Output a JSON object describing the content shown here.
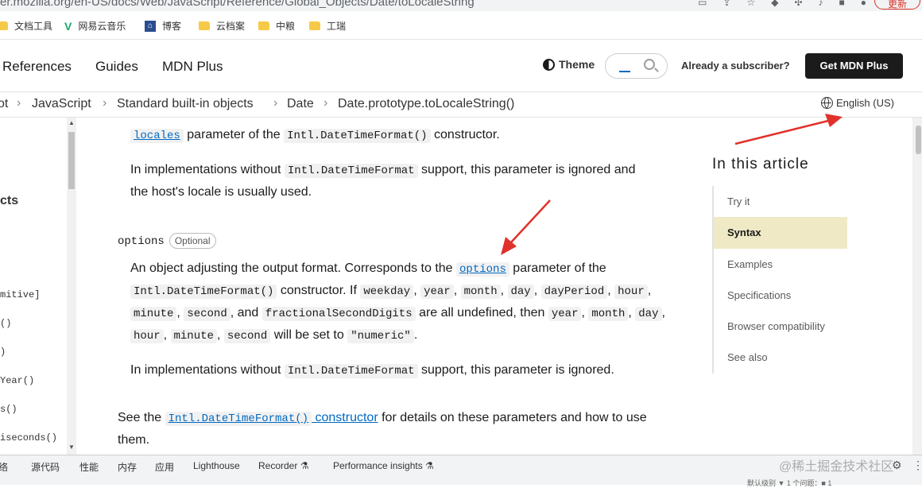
{
  "browser": {
    "url": "er.mozilla.org/en-US/docs/Web/JavaScript/Reference/Global_Objects/Date/toLocaleString",
    "update_label": "更新",
    "bookmarks": [
      "文档工具",
      "网易云音乐",
      "博客",
      "云档案",
      "中粮",
      "工瑞"
    ]
  },
  "header": {
    "nav": [
      "References",
      "Guides",
      "MDN Plus"
    ],
    "theme_label": "Theme",
    "subscriber_label": "Already a subscriber?",
    "cta_label": "Get MDN Plus"
  },
  "breadcrumb": {
    "items": [
      "ot",
      "JavaScript",
      "Standard built-in objects",
      "Date",
      "Date.prototype.toLocaleString()"
    ],
    "language": "English (US)"
  },
  "sidebar": {
    "heading": "cts",
    "items": [
      "mitive]",
      "()",
      ")",
      "Year()",
      "s()",
      "iseconds()"
    ]
  },
  "content": {
    "p1": {
      "link": "locales",
      "text1": "parameter of the",
      "code": "Intl.DateTimeFormat()",
      "text2": "constructor."
    },
    "p2": {
      "text1": "In implementations without",
      "code": "Intl.DateTimeFormat",
      "text2": "support, this parameter is ignored and",
      "line2": "the host's locale is usually used."
    },
    "options_term": "options",
    "optional_badge": "Optional",
    "p3": {
      "text1": "An object adjusting the output format. Corresponds to the",
      "link": "options",
      "text2": "parameter of the",
      "code_ctor": "Intl.DateTimeFormat()",
      "text3": "constructor. If",
      "codes": [
        "weekday",
        "year",
        "month",
        "day",
        "dayPeriod",
        "hour",
        "minute",
        "second",
        "fractionalSecondDigits",
        "year",
        "month",
        "day",
        "hour",
        "minute",
        "second",
        "\"numeric\""
      ],
      "and": "and",
      "undefined_then": "are all undefined, then",
      "will_be": "will be set to"
    },
    "p4": {
      "text1": "In implementations without",
      "code": "Intl.DateTimeFormat",
      "text2": "support, this parameter is ignored."
    },
    "p5": {
      "text1": "See the",
      "link_code": "Intl.DateTimeFormat()",
      "link_text": "constructor",
      "text2": "for details on these parameters and how to use",
      "line2": "them."
    }
  },
  "toc": {
    "title": "In this article",
    "items": [
      "Try it",
      "Syntax",
      "Examples",
      "Specifications",
      "Browser compatibility",
      "See also"
    ],
    "active": "Syntax"
  },
  "devtools": {
    "tabs": [
      "络",
      "源代码",
      "性能",
      "内存",
      "应用",
      "Lighthouse",
      "Recorder ⚗",
      "Performance insights ⚗"
    ],
    "watermark": "@稀土掘金技术社区",
    "bottom": "默认级别 ▼   1 个问题：■ 1"
  },
  "colors": {
    "link": "#0069c2",
    "active_toc": "#efe9c6",
    "cta_bg": "#1b1b1b",
    "arrow": "#e0322b"
  }
}
